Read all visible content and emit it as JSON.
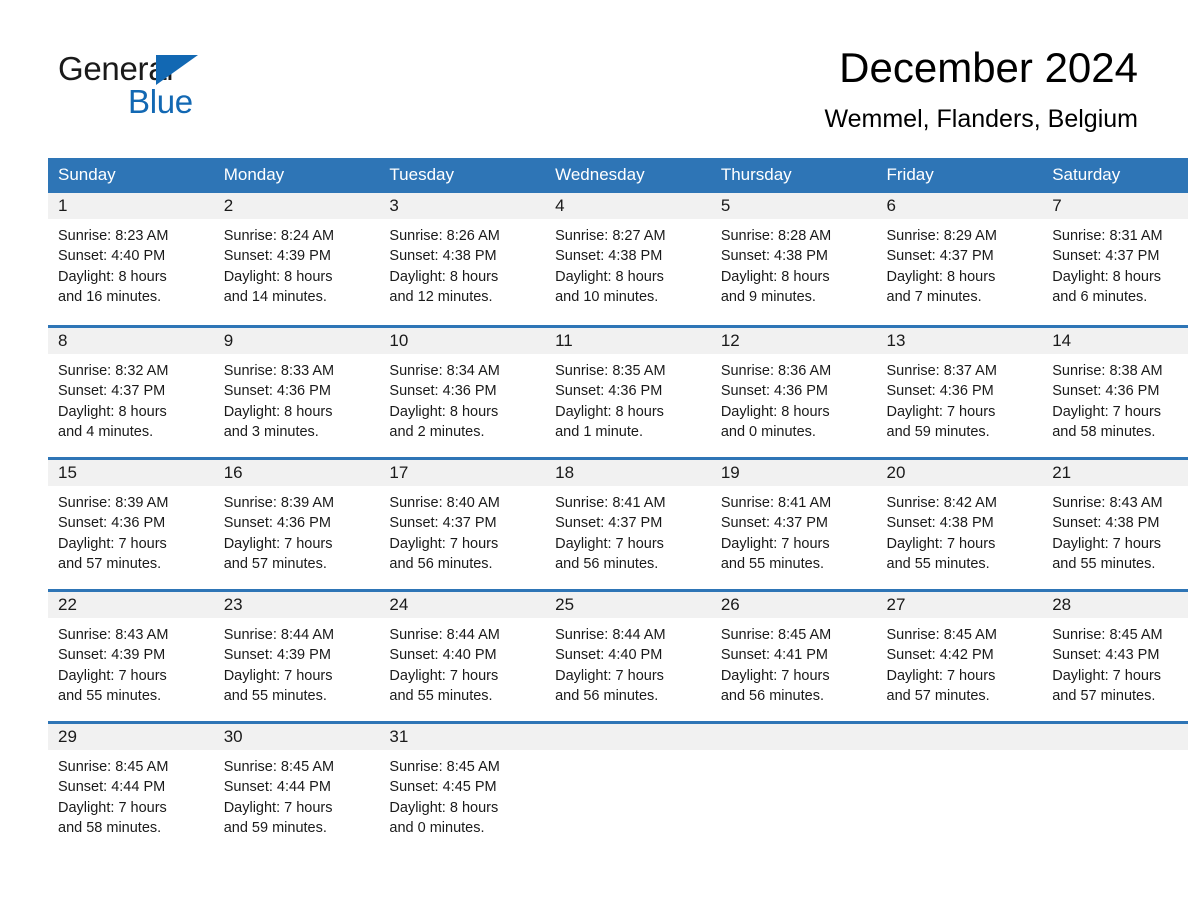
{
  "brand": {
    "name_top": "General",
    "name_bottom": "Blue",
    "accent_color": "#1268b3"
  },
  "header": {
    "title": "December 2024",
    "subtitle": "Wemmel, Flanders, Belgium"
  },
  "theme": {
    "header_blue": "#2e75b6",
    "daynum_gray": "#f1f1f1",
    "text": "#1a1a1a"
  },
  "weekday_headers": [
    "Sunday",
    "Monday",
    "Tuesday",
    "Wednesday",
    "Thursday",
    "Friday",
    "Saturday"
  ],
  "weeks": [
    [
      {
        "day": "1",
        "sunrise": "Sunrise: 8:23 AM",
        "sunset": "Sunset: 4:40 PM",
        "daylight1": "Daylight: 8 hours",
        "daylight2": "and 16 minutes."
      },
      {
        "day": "2",
        "sunrise": "Sunrise: 8:24 AM",
        "sunset": "Sunset: 4:39 PM",
        "daylight1": "Daylight: 8 hours",
        "daylight2": "and 14 minutes."
      },
      {
        "day": "3",
        "sunrise": "Sunrise: 8:26 AM",
        "sunset": "Sunset: 4:38 PM",
        "daylight1": "Daylight: 8 hours",
        "daylight2": "and 12 minutes."
      },
      {
        "day": "4",
        "sunrise": "Sunrise: 8:27 AM",
        "sunset": "Sunset: 4:38 PM",
        "daylight1": "Daylight: 8 hours",
        "daylight2": "and 10 minutes."
      },
      {
        "day": "5",
        "sunrise": "Sunrise: 8:28 AM",
        "sunset": "Sunset: 4:38 PM",
        "daylight1": "Daylight: 8 hours",
        "daylight2": "and 9 minutes."
      },
      {
        "day": "6",
        "sunrise": "Sunrise: 8:29 AM",
        "sunset": "Sunset: 4:37 PM",
        "daylight1": "Daylight: 8 hours",
        "daylight2": "and 7 minutes."
      },
      {
        "day": "7",
        "sunrise": "Sunrise: 8:31 AM",
        "sunset": "Sunset: 4:37 PM",
        "daylight1": "Daylight: 8 hours",
        "daylight2": "and 6 minutes."
      }
    ],
    [
      {
        "day": "8",
        "sunrise": "Sunrise: 8:32 AM",
        "sunset": "Sunset: 4:37 PM",
        "daylight1": "Daylight: 8 hours",
        "daylight2": "and 4 minutes."
      },
      {
        "day": "9",
        "sunrise": "Sunrise: 8:33 AM",
        "sunset": "Sunset: 4:36 PM",
        "daylight1": "Daylight: 8 hours",
        "daylight2": "and 3 minutes."
      },
      {
        "day": "10",
        "sunrise": "Sunrise: 8:34 AM",
        "sunset": "Sunset: 4:36 PM",
        "daylight1": "Daylight: 8 hours",
        "daylight2": "and 2 minutes."
      },
      {
        "day": "11",
        "sunrise": "Sunrise: 8:35 AM",
        "sunset": "Sunset: 4:36 PM",
        "daylight1": "Daylight: 8 hours",
        "daylight2": "and 1 minute."
      },
      {
        "day": "12",
        "sunrise": "Sunrise: 8:36 AM",
        "sunset": "Sunset: 4:36 PM",
        "daylight1": "Daylight: 8 hours",
        "daylight2": "and 0 minutes."
      },
      {
        "day": "13",
        "sunrise": "Sunrise: 8:37 AM",
        "sunset": "Sunset: 4:36 PM",
        "daylight1": "Daylight: 7 hours",
        "daylight2": "and 59 minutes."
      },
      {
        "day": "14",
        "sunrise": "Sunrise: 8:38 AM",
        "sunset": "Sunset: 4:36 PM",
        "daylight1": "Daylight: 7 hours",
        "daylight2": "and 58 minutes."
      }
    ],
    [
      {
        "day": "15",
        "sunrise": "Sunrise: 8:39 AM",
        "sunset": "Sunset: 4:36 PM",
        "daylight1": "Daylight: 7 hours",
        "daylight2": "and 57 minutes."
      },
      {
        "day": "16",
        "sunrise": "Sunrise: 8:39 AM",
        "sunset": "Sunset: 4:36 PM",
        "daylight1": "Daylight: 7 hours",
        "daylight2": "and 57 minutes."
      },
      {
        "day": "17",
        "sunrise": "Sunrise: 8:40 AM",
        "sunset": "Sunset: 4:37 PM",
        "daylight1": "Daylight: 7 hours",
        "daylight2": "and 56 minutes."
      },
      {
        "day": "18",
        "sunrise": "Sunrise: 8:41 AM",
        "sunset": "Sunset: 4:37 PM",
        "daylight1": "Daylight: 7 hours",
        "daylight2": "and 56 minutes."
      },
      {
        "day": "19",
        "sunrise": "Sunrise: 8:41 AM",
        "sunset": "Sunset: 4:37 PM",
        "daylight1": "Daylight: 7 hours",
        "daylight2": "and 55 minutes."
      },
      {
        "day": "20",
        "sunrise": "Sunrise: 8:42 AM",
        "sunset": "Sunset: 4:38 PM",
        "daylight1": "Daylight: 7 hours",
        "daylight2": "and 55 minutes."
      },
      {
        "day": "21",
        "sunrise": "Sunrise: 8:43 AM",
        "sunset": "Sunset: 4:38 PM",
        "daylight1": "Daylight: 7 hours",
        "daylight2": "and 55 minutes."
      }
    ],
    [
      {
        "day": "22",
        "sunrise": "Sunrise: 8:43 AM",
        "sunset": "Sunset: 4:39 PM",
        "daylight1": "Daylight: 7 hours",
        "daylight2": "and 55 minutes."
      },
      {
        "day": "23",
        "sunrise": "Sunrise: 8:44 AM",
        "sunset": "Sunset: 4:39 PM",
        "daylight1": "Daylight: 7 hours",
        "daylight2": "and 55 minutes."
      },
      {
        "day": "24",
        "sunrise": "Sunrise: 8:44 AM",
        "sunset": "Sunset: 4:40 PM",
        "daylight1": "Daylight: 7 hours",
        "daylight2": "and 55 minutes."
      },
      {
        "day": "25",
        "sunrise": "Sunrise: 8:44 AM",
        "sunset": "Sunset: 4:40 PM",
        "daylight1": "Daylight: 7 hours",
        "daylight2": "and 56 minutes."
      },
      {
        "day": "26",
        "sunrise": "Sunrise: 8:45 AM",
        "sunset": "Sunset: 4:41 PM",
        "daylight1": "Daylight: 7 hours",
        "daylight2": "and 56 minutes."
      },
      {
        "day": "27",
        "sunrise": "Sunrise: 8:45 AM",
        "sunset": "Sunset: 4:42 PM",
        "daylight1": "Daylight: 7 hours",
        "daylight2": "and 57 minutes."
      },
      {
        "day": "28",
        "sunrise": "Sunrise: 8:45 AM",
        "sunset": "Sunset: 4:43 PM",
        "daylight1": "Daylight: 7 hours",
        "daylight2": "and 57 minutes."
      }
    ],
    [
      {
        "day": "29",
        "sunrise": "Sunrise: 8:45 AM",
        "sunset": "Sunset: 4:44 PM",
        "daylight1": "Daylight: 7 hours",
        "daylight2": "and 58 minutes."
      },
      {
        "day": "30",
        "sunrise": "Sunrise: 8:45 AM",
        "sunset": "Sunset: 4:44 PM",
        "daylight1": "Daylight: 7 hours",
        "daylight2": "and 59 minutes."
      },
      {
        "day": "31",
        "sunrise": "Sunrise: 8:45 AM",
        "sunset": "Sunset: 4:45 PM",
        "daylight1": "Daylight: 8 hours",
        "daylight2": "and 0 minutes."
      },
      {
        "day": "",
        "sunrise": "",
        "sunset": "",
        "daylight1": "",
        "daylight2": ""
      },
      {
        "day": "",
        "sunrise": "",
        "sunset": "",
        "daylight1": "",
        "daylight2": ""
      },
      {
        "day": "",
        "sunrise": "",
        "sunset": "",
        "daylight1": "",
        "daylight2": ""
      },
      {
        "day": "",
        "sunrise": "",
        "sunset": "",
        "daylight1": "",
        "daylight2": ""
      }
    ]
  ]
}
